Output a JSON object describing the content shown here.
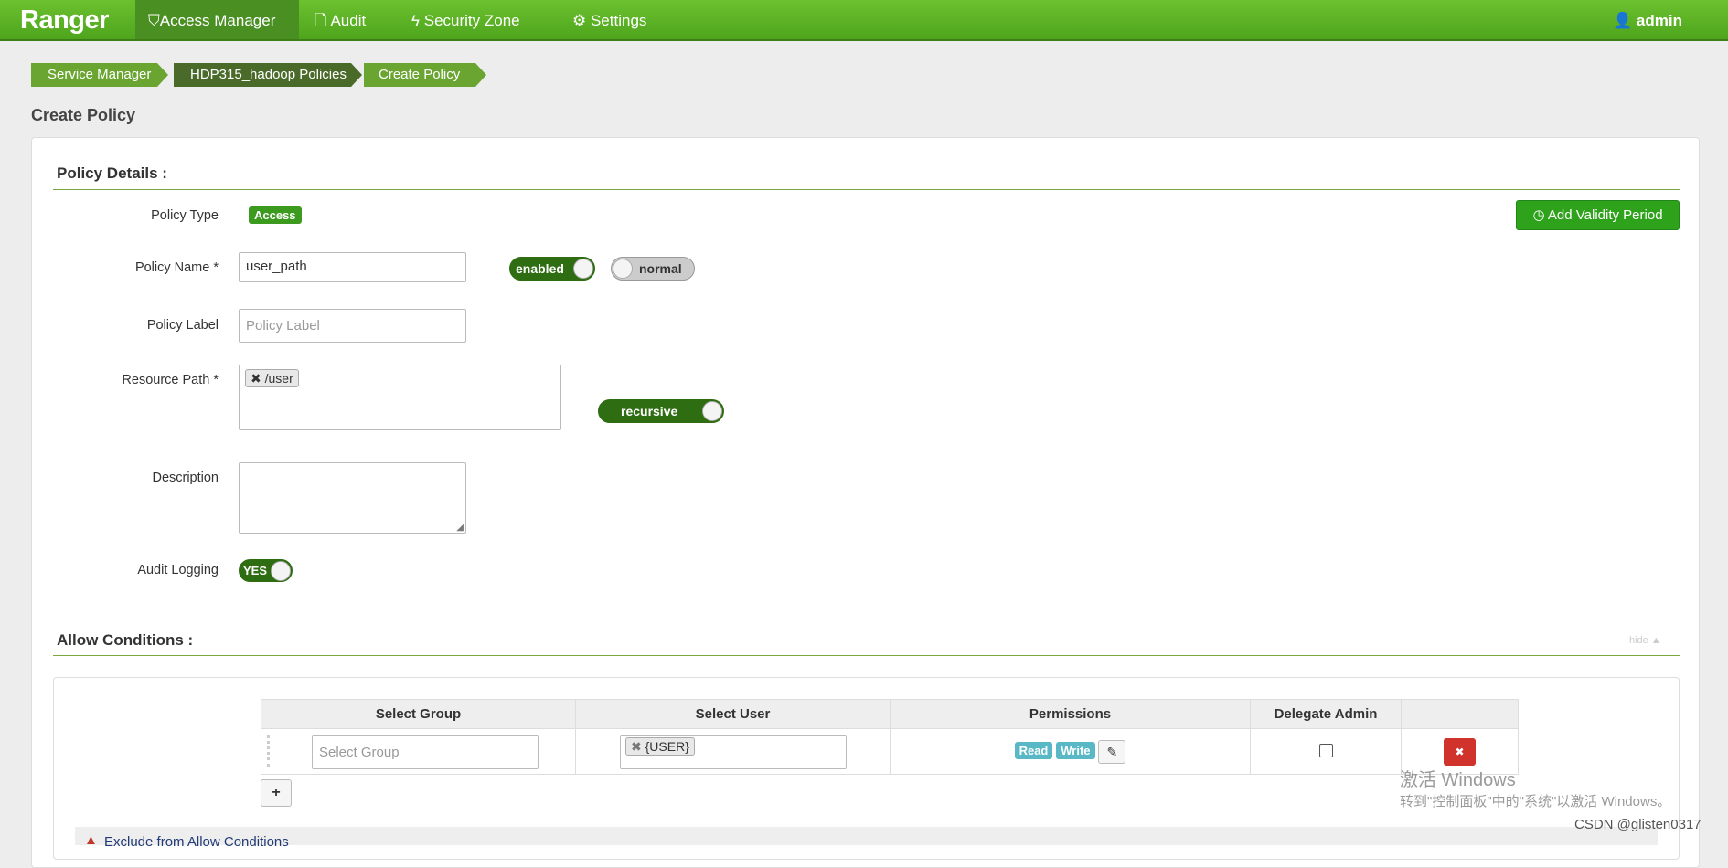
{
  "nav": {
    "logo": "Ranger",
    "items": [
      {
        "label": "Access Manager",
        "icon": "shield-icon"
      },
      {
        "label": "Audit",
        "icon": "file-icon"
      },
      {
        "label": "Security Zone",
        "icon": "bolt-icon"
      },
      {
        "label": "Settings",
        "icon": "gear-icon"
      }
    ],
    "user": "admin"
  },
  "breadcrumb": [
    "Service Manager",
    "HDP315_hadoop Policies",
    "Create Policy"
  ],
  "page_title": "Create Policy",
  "details": {
    "heading": "Policy Details :",
    "add_validity": "Add Validity Period",
    "policy_type_label": "Policy Type",
    "policy_type": "Access",
    "policy_name_label": "Policy Name *",
    "policy_name": "user_path",
    "enabled": "enabled",
    "normal": "normal",
    "policy_label_label": "Policy Label",
    "policy_label_placeholder": "Policy Label",
    "resource_path_label": "Resource Path *",
    "resource_path_tag": "/user",
    "recursive": "recursive",
    "description_label": "Description",
    "audit_logging_label": "Audit Logging",
    "audit_logging": "YES"
  },
  "allow": {
    "heading": "Allow Conditions :",
    "hide": "hide ▲",
    "columns": [
      "Select Group",
      "Select User",
      "Permissions",
      "Delegate Admin",
      ""
    ],
    "row": {
      "group_placeholder": "Select Group",
      "user_tag": "{USER}",
      "permissions": [
        "Read",
        "Write"
      ],
      "delegate_admin": false
    },
    "add": "+"
  },
  "exclude": {
    "label": "Exclude from Allow Conditions"
  },
  "watermark": {
    "line1": "激活 Windows",
    "line2": "转到\"控制面板\"中的\"系统\"以激活 Windows。",
    "csdn": "CSDN @glisten0317"
  }
}
